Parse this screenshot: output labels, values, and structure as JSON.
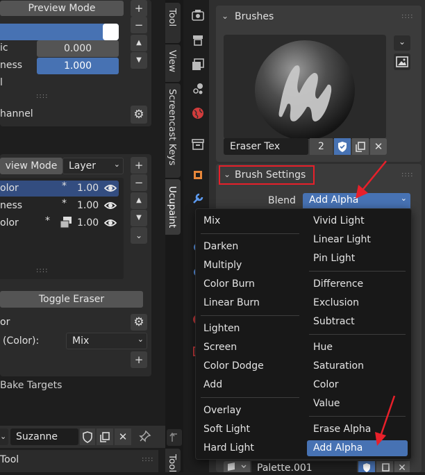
{
  "left_top": {
    "preview_mode_button": "Preview Mode",
    "rows": [
      {
        "label": "ic",
        "value": "0.000"
      },
      {
        "label": "ness",
        "value": "1.000"
      },
      {
        "label": "l",
        "value": ""
      }
    ],
    "channel_label": "hannel"
  },
  "layers": {
    "dropdown_left": "view Mode",
    "dropdown_right": "Layer",
    "items": [
      {
        "label": "olor",
        "star": "*",
        "value": "1.00"
      },
      {
        "label": "ness",
        "star": "*",
        "value": "1.00"
      },
      {
        "label": "olor",
        "star": "*",
        "value": "1.00"
      }
    ],
    "toggle_eraser": "Toggle Eraser",
    "or_label": "or",
    "color_label": "(Color):",
    "color_mode": "Mix",
    "bake_targets": "Bake Targets"
  },
  "bottom_left": {
    "object_name": "Suzanne",
    "tool_label": "Tool"
  },
  "vertical_tabs": [
    "Tool",
    "View",
    "Screencast Keys",
    "Ucupaint",
    "Tool"
  ],
  "brushes": {
    "header": "Brushes",
    "brush_name": "Eraser Tex",
    "user_count": "2"
  },
  "brush_settings": {
    "header": "Brush Settings",
    "blend_label": "Blend",
    "blend_value": "Add Alpha"
  },
  "blend_menu": {
    "left_groups": [
      [
        "Mix"
      ],
      [
        "Darken",
        "Multiply",
        "Color Burn",
        "Linear Burn"
      ],
      [
        "Lighten",
        "Screen",
        "Color Dodge",
        "Add"
      ],
      [
        "Overlay",
        "Soft Light",
        "Hard Light"
      ]
    ],
    "right_groups": [
      [
        "Vivid Light",
        "Linear Light",
        "Pin Light"
      ],
      [
        "Difference",
        "Exclusion",
        "Subtract"
      ],
      [
        "Hue",
        "Saturation",
        "Color",
        "Value"
      ],
      [
        "Erase Alpha",
        "Add Alpha"
      ]
    ],
    "selected": "Add Alpha"
  },
  "palette": {
    "name": "Palette.001"
  },
  "colors": {
    "accent_blue": "#4772b3",
    "highlight_red": "#e8202a",
    "panel_bg": "#2b2b2b",
    "field_bg": "#545454"
  }
}
